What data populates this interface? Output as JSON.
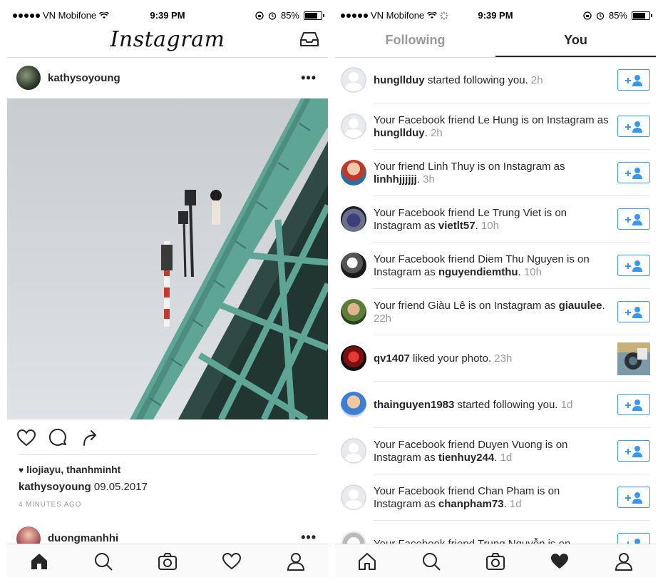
{
  "status_left": {
    "carrier": "VN Mobifone",
    "time": "9:39 PM",
    "battery": "85%"
  },
  "status_right": {
    "carrier": "VN Mobifone",
    "time": "9:39 PM",
    "battery": "85%"
  },
  "feed": {
    "logo": "Instagram",
    "post": {
      "username": "kathysoyoung",
      "more": "•••",
      "likes": "liojiayu, thanhminht",
      "caption_user": "kathysoyoung",
      "caption_text": " 09.05.2017",
      "time_ago": "4 MINUTES AGO"
    },
    "next_post": {
      "username": "duongmanhhi",
      "more": "•••"
    }
  },
  "activity": {
    "tabs": {
      "following": "Following",
      "you": "You"
    },
    "items": [
      {
        "pre": "",
        "user": "hungllduy",
        "mid": " started following you.",
        "user2": "",
        "end": "",
        "time": " 2h",
        "avatar": "default",
        "action": "follow"
      },
      {
        "pre": "Your Facebook friend Le Hung is on Instagram as ",
        "user": "",
        "mid": "",
        "user2": "hungllduy",
        "end": ".",
        "time": " 2h",
        "avatar": "default",
        "action": "follow"
      },
      {
        "pre": "Your friend Linh Thuy is on Instagram as ",
        "user": "",
        "mid": "",
        "user2": "linhhjjjjjj",
        "end": ".",
        "time": " 3h",
        "avatar": "photo1",
        "action": "follow"
      },
      {
        "pre": "Your Facebook friend Le Trung Viet is on Instagram as ",
        "user": "",
        "mid": "",
        "user2": "vietlt57",
        "end": ".",
        "time": " 10h",
        "avatar": "photo2",
        "action": "follow"
      },
      {
        "pre": "Your Facebook friend Diem Thu Nguyen is on Instagram as ",
        "user": "",
        "mid": "",
        "user2": "nguyendiemthu",
        "end": ".",
        "time": " 10h",
        "avatar": "photo3",
        "action": "follow"
      },
      {
        "pre": "Your friend Giàu Lê is on Instagram as ",
        "user": "",
        "mid": "",
        "user2": "giauulee",
        "end": ".",
        "time": " 22h",
        "avatar": "photo4",
        "action": "follow"
      },
      {
        "pre": "",
        "user": "qv1407",
        "mid": " liked your photo.",
        "user2": "",
        "end": "",
        "time": " 23h",
        "avatar": "photo5",
        "action": "thumb"
      },
      {
        "pre": "",
        "user": "thainguyen1983",
        "mid": " started following you.",
        "user2": "",
        "end": "",
        "time": " 1d",
        "avatar": "photo6",
        "action": "follow"
      },
      {
        "pre": "Your Facebook friend Duyen Vuong is on Instagram as ",
        "user": "",
        "mid": "",
        "user2": "tienhuy244",
        "end": ".",
        "time": " 1d",
        "avatar": "default",
        "action": "follow"
      },
      {
        "pre": "Your Facebook friend Chan Pham is on Instagram as ",
        "user": "",
        "mid": "",
        "user2": "chanpham73",
        "end": ".",
        "time": " 1d",
        "avatar": "default",
        "action": "follow"
      },
      {
        "pre": "Your Facebook friend Trung Nguyễn is on",
        "user": "",
        "mid": "",
        "user2": "",
        "end": "",
        "time": "",
        "avatar": "photo7",
        "action": "follow"
      }
    ]
  },
  "colors": {
    "accent": "#3897f0",
    "text": "#262626",
    "muted": "#999999",
    "divider": "#dbdbdb",
    "bridge": "#5fa596"
  },
  "icons": {
    "feed_header": "inbox-icon",
    "post_actions": [
      "heart-icon",
      "comment-icon",
      "share-icon"
    ],
    "nav": [
      "home-icon",
      "search-icon",
      "camera-icon",
      "heart-icon",
      "profile-icon"
    ]
  }
}
